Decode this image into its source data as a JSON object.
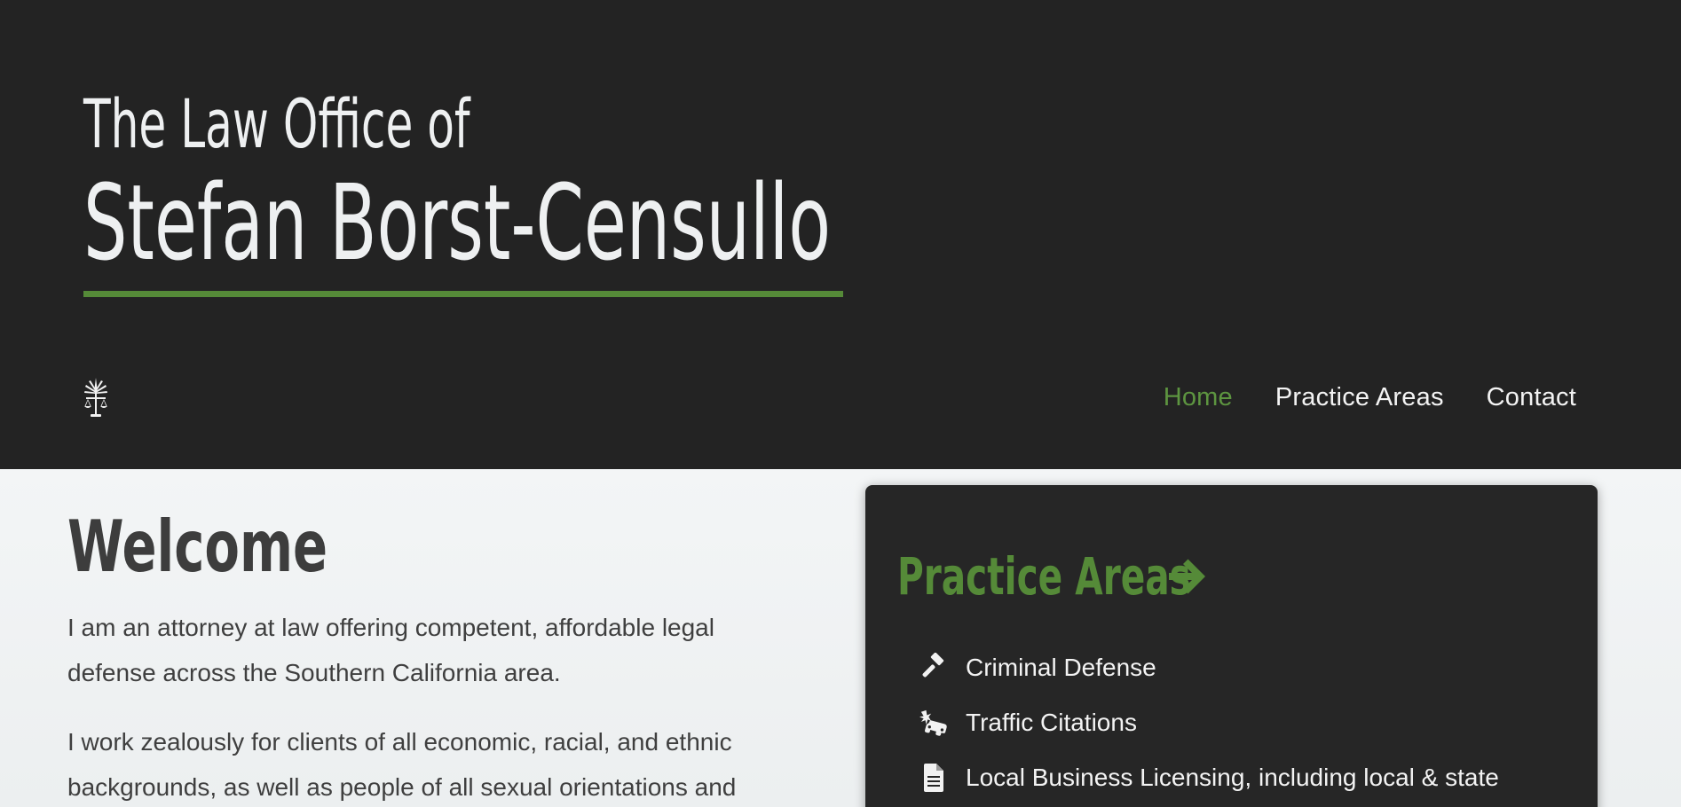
{
  "header": {
    "title_line1": "The Law Office of",
    "title_line2": "Stefan Borst-Censullo",
    "logo_icon": "scales-of-justice-icon",
    "nav": [
      {
        "label": "Home",
        "active": true
      },
      {
        "label": "Practice Areas",
        "active": false
      },
      {
        "label": "Contact",
        "active": false
      }
    ]
  },
  "main": {
    "welcome": {
      "title": "Welcome",
      "paragraphs": [
        "I am an attorney at law offering competent, affordable legal defense across the Southern California area.",
        "I work zealously for clients of all economic, racial, and ethnic backgrounds, as well as people of all sexual orientations and"
      ]
    },
    "practice_card": {
      "title": "Practice Areas",
      "title_icon": "arrow-right-icon",
      "items": [
        {
          "label": "Criminal Defense",
          "icon": "gavel-icon"
        },
        {
          "label": "Traffic Citations",
          "icon": "car-crash-icon"
        },
        {
          "label": "Local Business Licensing, including local & state",
          "icon": "document-icon"
        }
      ]
    }
  },
  "colors": {
    "header_bg": "#232323",
    "accent_green": "#558a38",
    "nav_active": "#5d9540",
    "card_bg": "#262626",
    "main_bg": "#eff2f3",
    "text_dark": "#3f3f3f"
  }
}
